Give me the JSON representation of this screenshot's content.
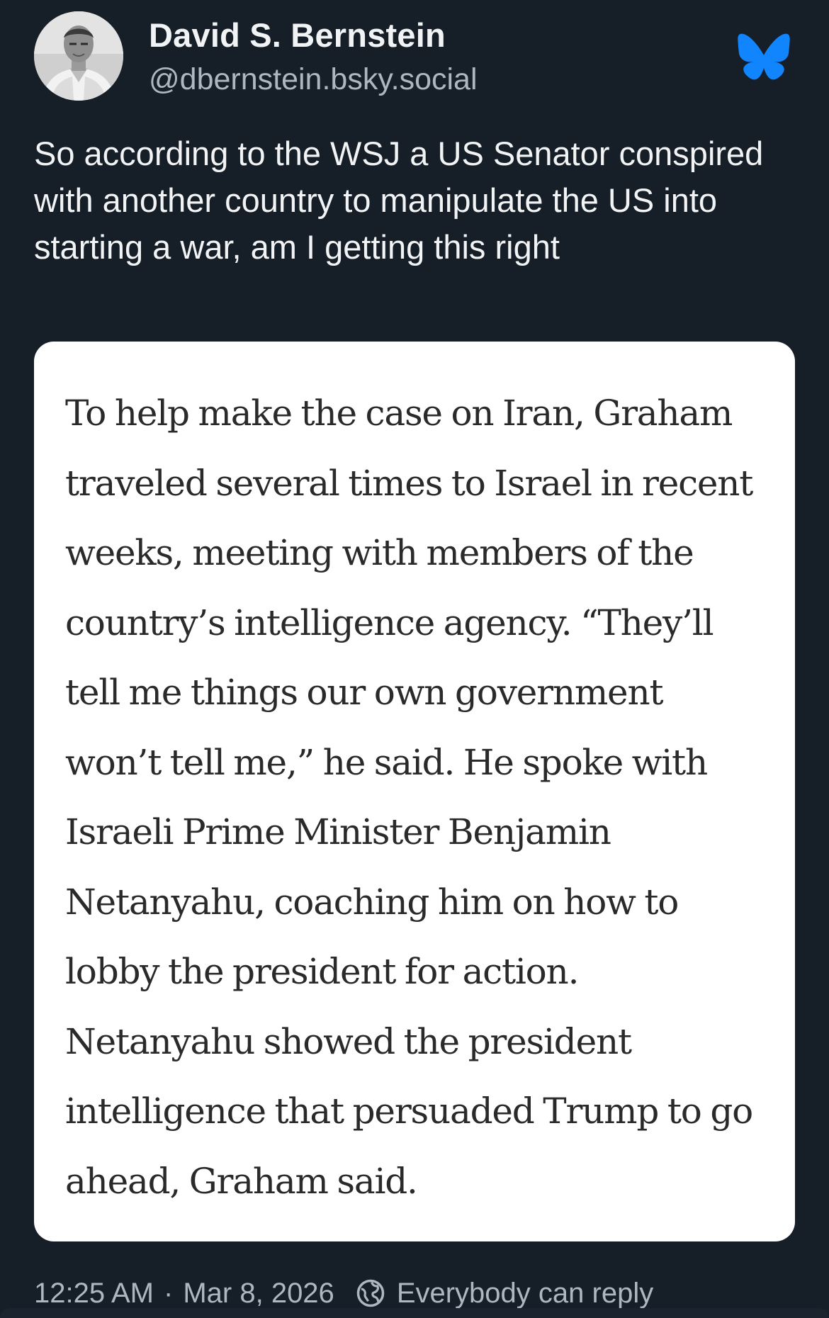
{
  "author": {
    "display_name": "David S. Bernstein",
    "handle": "@dbernstein.bsky.social",
    "avatar_icon": "profile-photo"
  },
  "brand": {
    "icon": "bluesky-butterfly-icon",
    "color": "#1185fe"
  },
  "post": {
    "text": "So according to the WSJ a US Senator conspired with another country to manipulate the US into starting a war, am I getting this right"
  },
  "quote_image": {
    "text": "To help make the case on Iran, Graham traveled several times to Israel in recent weeks, meeting with members of the country’s intelligence agency. “They’ll tell me things our own government won’t tell me,” he said. He spoke with Israeli Prime Minister Benjamin Netanyahu, coaching him on how to lobby the president for action. Netanyahu showed the president intelligence that persuaded Trump to go ahead, Graham said."
  },
  "footer": {
    "time": "12:25 AM",
    "separator": "·",
    "date": "Mar 8, 2026",
    "reply_setting_icon": "globe-reply-icon",
    "reply_setting": "Everybody can reply"
  },
  "colors": {
    "background": "#161e27",
    "text_primary": "#f1f3f5",
    "text_secondary": "#aeb7c1",
    "card_background": "#ffffff",
    "card_text": "#2a2a2a"
  }
}
